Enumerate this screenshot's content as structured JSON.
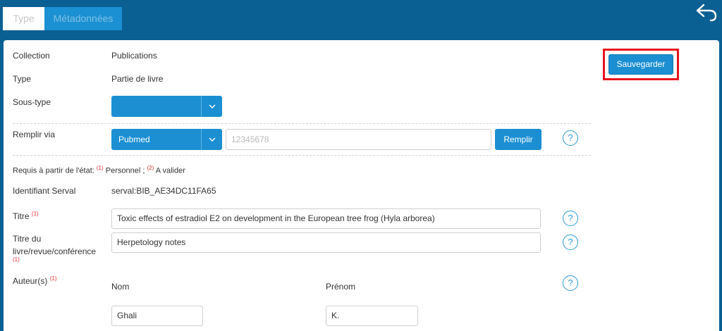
{
  "tabs": [
    {
      "label": "Type"
    },
    {
      "label": "Métadonnées"
    }
  ],
  "toolbar": {
    "back_icon": "back-arrow-icon"
  },
  "save": {
    "label": "Sauvegarder",
    "highlight_color": "#e8141e"
  },
  "fields": {
    "collection": {
      "label": "Collection",
      "value": "Publications"
    },
    "type": {
      "label": "Type",
      "value": "Partie de livre"
    },
    "subtype": {
      "label": "Sous-type",
      "value": ""
    },
    "fill_via": {
      "label": "Remplir via",
      "source": "Pubmed",
      "placeholder": "12345678",
      "button": "Remplir",
      "help": "?"
    },
    "required_note": {
      "prefix": "Requis à partir de l'état:",
      "m1": "(1)",
      "state1": "Personnel",
      "sep": ";",
      "m2": "(2)",
      "state2": "A valider"
    },
    "serval_id": {
      "label": "Identifiant Serval",
      "value": "serval:BIB_AE34DC11FA65"
    },
    "title": {
      "label": "Titre",
      "marker": "(1)",
      "value": "Toxic effects of estradiol E2 on development in the European tree frog (Hyla arborea)",
      "help": "?"
    },
    "book_title": {
      "label_line1": "Titre du",
      "label_line2": "livre/revue/conférence",
      "marker": "(1)",
      "value": "Herpetology notes",
      "help": "?"
    },
    "authors": {
      "label": "Auteur(s)",
      "marker": "(1)",
      "col_last": "Nom",
      "col_first": "Prénom",
      "help": "?",
      "rows": [
        {
          "last": "Ghali",
          "first": "K."
        }
      ]
    }
  },
  "colors": {
    "header_bg": "#0a5f93",
    "accent": "#1b8fd2",
    "required_marker": "#e53030"
  }
}
